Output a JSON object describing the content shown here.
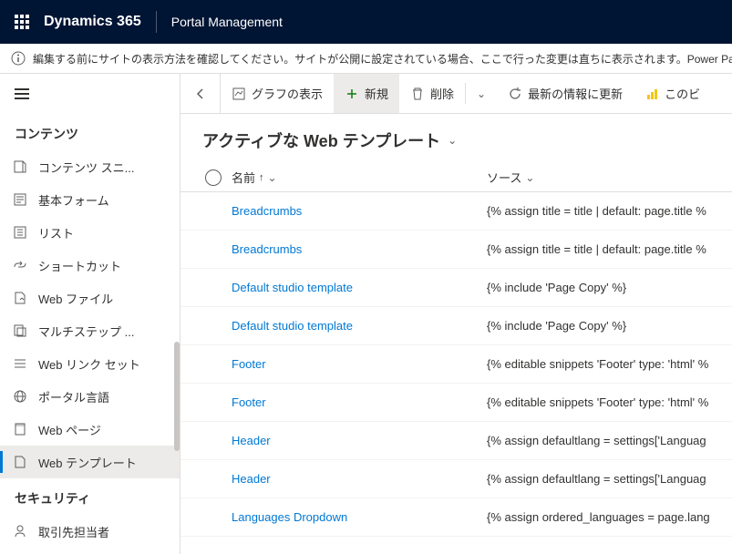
{
  "header": {
    "brand": "Dynamics 365",
    "app": "Portal Management"
  },
  "notice": "編集する前にサイトの表示方法を確認してください。サイトが公開に設定されている場合、ここで行った変更は直ちに表示されます。Power Pa",
  "sidebar": {
    "group1": "コンテンツ",
    "items1": [
      "コンテンツ スニ...",
      "基本フォーム",
      "リスト",
      "ショートカット",
      "Web ファイル",
      "マルチステップ ...",
      "Web リンク セット",
      "ポータル言語",
      "Web ページ",
      "Web テンプレート"
    ],
    "group2": "セキュリティ",
    "items2": [
      "取引先担当者"
    ]
  },
  "commands": {
    "chart": "グラフの表示",
    "new": "新規",
    "delete": "削除",
    "refresh": "最新の情報に更新",
    "powerbi": "このビ"
  },
  "view": {
    "title": "アクティブな Web テンプレート"
  },
  "columns": {
    "name": "名前",
    "source": "ソース"
  },
  "rows": [
    {
      "name": "Breadcrumbs",
      "source": "{% assign title = title | default: page.title %"
    },
    {
      "name": "Breadcrumbs",
      "source": "{% assign title = title | default: page.title %"
    },
    {
      "name": "Default studio template",
      "source": "{% include 'Page Copy' %}"
    },
    {
      "name": "Default studio template",
      "source": "{% include 'Page Copy' %}"
    },
    {
      "name": "Footer",
      "source": "{% editable snippets 'Footer' type: 'html' %"
    },
    {
      "name": "Footer",
      "source": "{% editable snippets 'Footer' type: 'html' %"
    },
    {
      "name": "Header",
      "source": "{% assign defaultlang = settings['Languag"
    },
    {
      "name": "Header",
      "source": "{% assign defaultlang = settings['Languag"
    },
    {
      "name": "Languages Dropdown",
      "source": "{% assign ordered_languages = page.lang"
    }
  ]
}
